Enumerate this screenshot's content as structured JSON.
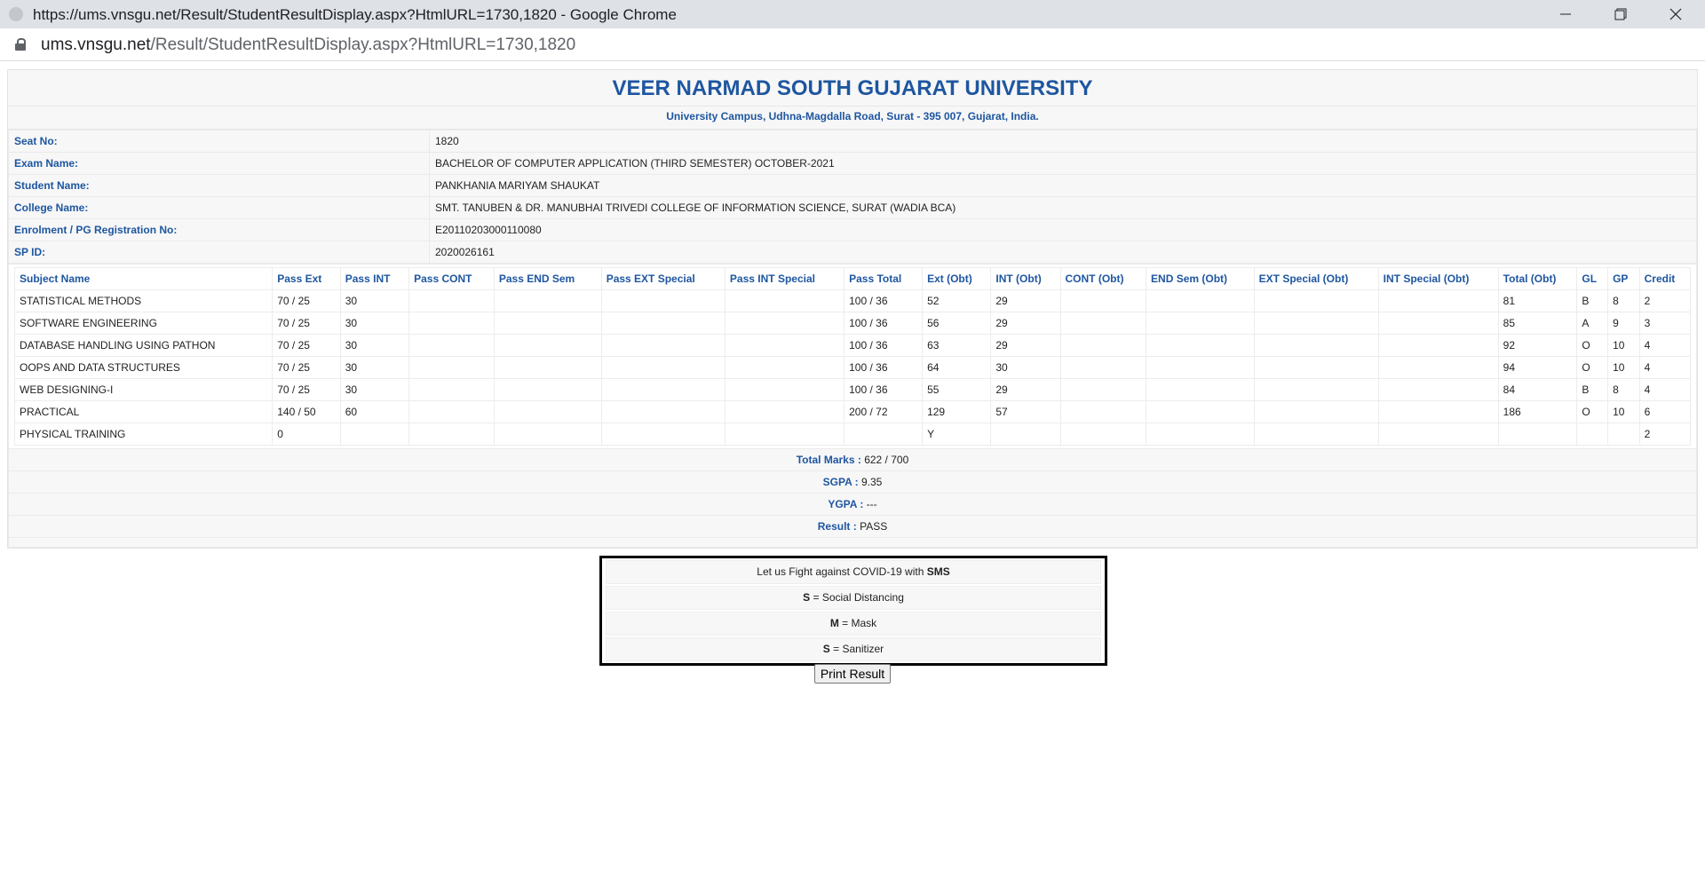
{
  "browser": {
    "window_title": "https://ums.vnsgu.net/Result/StudentResultDisplay.aspx?HtmlURL=1730,1820 - Google Chrome",
    "url_host": "ums.vnsgu.net",
    "url_path": "/Result/StudentResultDisplay.aspx?HtmlURL=1730,1820",
    "minimize_icon": "minimize-icon",
    "maximize_icon": "restore-icon",
    "close_icon": "close-icon"
  },
  "header": {
    "university": "VEER NARMAD SOUTH GUJARAT UNIVERSITY",
    "address": "University Campus, Udhna-Magdalla Road, Surat - 395 007, Gujarat, India."
  },
  "student_info": [
    {
      "label": "Seat No:",
      "value": "1820"
    },
    {
      "label": "Exam Name:",
      "value": "BACHELOR OF COMPUTER APPLICATION (THIRD SEMESTER) OCTOBER-2021"
    },
    {
      "label": "Student Name:",
      "value": "PANKHANIA MARIYAM SHAUKAT"
    },
    {
      "label": "College Name:",
      "value": "SMT. TANUBEN & DR. MANUBHAI TRIVEDI COLLEGE OF INFORMATION SCIENCE, SURAT (WADIA BCA)"
    },
    {
      "label": "Enrolment / PG Registration No:",
      "value": "E20110203000110080"
    },
    {
      "label": "SP ID:",
      "value": "2020026161"
    }
  ],
  "marks_table": {
    "headers": [
      "Subject Name",
      "Pass Ext",
      "Pass INT",
      "Pass CONT",
      "Pass END Sem",
      "Pass EXT Special",
      "Pass INT Special",
      "Pass Total",
      "Ext (Obt)",
      "INT (Obt)",
      "CONT (Obt)",
      "END Sem (Obt)",
      "EXT Special (Obt)",
      "INT Special (Obt)",
      "Total (Obt)",
      "GL",
      "GP",
      "Credit"
    ],
    "rows": [
      [
        "STATISTICAL METHODS",
        "70 / 25",
        "30",
        "",
        "",
        "",
        "",
        "100 / 36",
        "52",
        "29",
        "",
        "",
        "",
        "",
        "81",
        "B",
        "8",
        "2"
      ],
      [
        "SOFTWARE ENGINEERING",
        "70 / 25",
        "30",
        "",
        "",
        "",
        "",
        "100 / 36",
        "56",
        "29",
        "",
        "",
        "",
        "",
        "85",
        "A",
        "9",
        "3"
      ],
      [
        "DATABASE HANDLING USING PATHON",
        "70 / 25",
        "30",
        "",
        "",
        "",
        "",
        "100 / 36",
        "63",
        "29",
        "",
        "",
        "",
        "",
        "92",
        "O",
        "10",
        "4"
      ],
      [
        "OOPS AND DATA STRUCTURES",
        "70 / 25",
        "30",
        "",
        "",
        "",
        "",
        "100 / 36",
        "64",
        "30",
        "",
        "",
        "",
        "",
        "94",
        "O",
        "10",
        "4"
      ],
      [
        "WEB DESIGNING-I",
        "70 / 25",
        "30",
        "",
        "",
        "",
        "",
        "100 / 36",
        "55",
        "29",
        "",
        "",
        "",
        "",
        "84",
        "B",
        "8",
        "4"
      ],
      [
        "PRACTICAL",
        "140 / 50",
        "60",
        "",
        "",
        "",
        "",
        "200 / 72",
        "129",
        "57",
        "",
        "",
        "",
        "",
        "186",
        "O",
        "10",
        "6"
      ],
      [
        "PHYSICAL TRAINING",
        "0",
        "",
        "",
        "",
        "",
        "",
        "",
        "Y",
        "",
        "",
        "",
        "",
        "",
        "",
        "",
        "",
        "2"
      ]
    ]
  },
  "summary": {
    "total_label": "Total Marks :",
    "total_value": " 622 / 700",
    "sgpa_label": "SGPA :",
    "sgpa_value": " 9.35",
    "ygpa_label": "YGPA :",
    "ygpa_value": " ---",
    "result_label": "Result :",
    "result_value": " PASS"
  },
  "covid": {
    "line1_text": "Let us Fight against COVID-19 with ",
    "line1_bold": "SMS",
    "s1_letter": "S",
    "s1_text": " = Social Distancing",
    "m_letter": "M",
    "m_text": " = Mask",
    "s2_letter": "S",
    "s2_text": " = Sanitizer"
  },
  "print_button": "Print Result"
}
